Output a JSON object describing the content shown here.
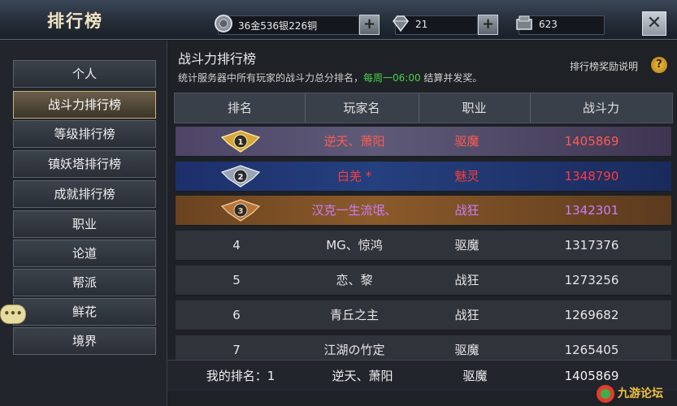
{
  "header": {
    "title": "排行榜",
    "currency_label": "36金536银226铜",
    "diamond_label": "21",
    "voucher_label": "623",
    "plus_label": "+",
    "close_label": "✕"
  },
  "sidebar": {
    "items": [
      {
        "label": "个人",
        "active": false
      },
      {
        "label": "战斗力排行榜",
        "active": true
      },
      {
        "label": "等级排行榜",
        "active": false
      },
      {
        "label": "镇妖塔排行榜",
        "active": false
      },
      {
        "label": "成就排行榜",
        "active": false
      },
      {
        "label": "职业",
        "active": false
      },
      {
        "label": "论道",
        "active": false
      },
      {
        "label": "帮派",
        "active": false
      },
      {
        "label": "鲜花",
        "active": false
      },
      {
        "label": "境界",
        "active": false
      }
    ],
    "chat_label": "•••"
  },
  "panel": {
    "title": "战斗力排行榜",
    "desc_prefix": "统计服务器中所有玩家的战斗力总分排名，",
    "desc_highlight": "每周一06:00",
    "desc_suffix": " 结算并发奖。",
    "reward_link": "排行榜奖励说明",
    "help_label": "?"
  },
  "table": {
    "headers": [
      "排名",
      "玩家名",
      "职业",
      "战斗力"
    ],
    "rows": [
      {
        "rank": "1",
        "name": "逆天、萧阳",
        "class": "驱魔",
        "power": "1405869",
        "color": "#ff5a50"
      },
      {
        "rank": "2",
        "name": "白羌 *",
        "class": "魅灵",
        "power": "1348790",
        "color": "#ff3b3b"
      },
      {
        "rank": "3",
        "name": "汉克一生流氓、",
        "class": "战狂",
        "power": "1342301",
        "color": "#c77dff"
      },
      {
        "rank": "4",
        "name": "MG、惊鸿",
        "class": "驱魔",
        "power": "1317376",
        "color": "#e6e6e6"
      },
      {
        "rank": "5",
        "name": "恋、黎",
        "class": "战狂",
        "power": "1273256",
        "color": "#e6e6e6"
      },
      {
        "rank": "6",
        "name": "青丘之主",
        "class": "战狂",
        "power": "1269682",
        "color": "#e6e6e6"
      },
      {
        "rank": "7",
        "name": "江湖の竹定",
        "class": "驱魔",
        "power": "1265405",
        "color": "#e6e6e6"
      }
    ]
  },
  "my_rank": {
    "label": "我的排名：1",
    "name": "逆天、萧阳",
    "class": "驱魔",
    "power": "1405869"
  },
  "watermark": {
    "text": "九游论坛"
  }
}
